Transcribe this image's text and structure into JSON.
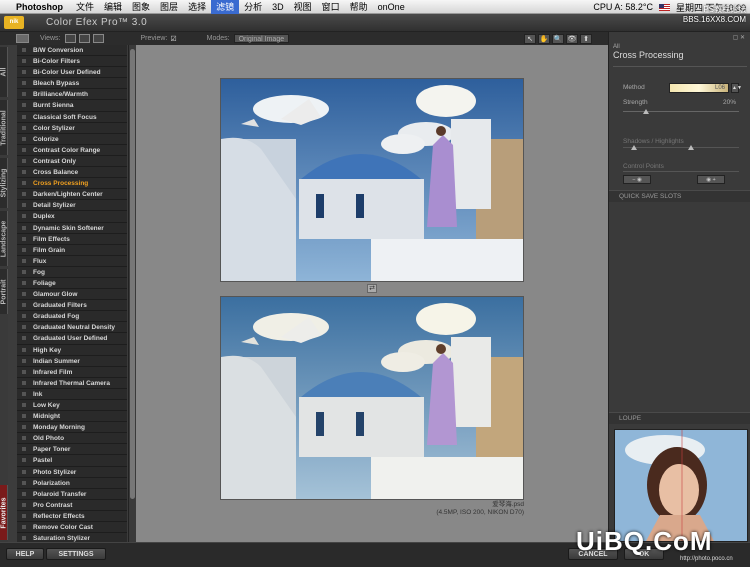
{
  "menubar": {
    "app": "Photoshop",
    "items": [
      "文件",
      "编辑",
      "图象",
      "图层",
      "选择",
      "滤镜",
      "分析",
      "3D",
      "视图",
      "窗口",
      "帮助",
      "onOne"
    ],
    "active_index": 5,
    "status": "CPU A: 58.2°C",
    "clock": "星期四 下午10:00"
  },
  "titlebar": {
    "logo": "nik",
    "title": "Color Efex Pro™ 3.0"
  },
  "toolbar": {
    "views_label": "Views:",
    "preview_label": "Preview:",
    "preview_checked": "☑",
    "modes_label": "Modes:",
    "modes_value": "Original Image",
    "tools": [
      "↖",
      "✋",
      "🔍",
      "👁",
      "⬆"
    ]
  },
  "tabs": [
    "All",
    "Traditional",
    "Stylizing",
    "Landscape",
    "Portrait",
    "Favorites"
  ],
  "filters": [
    "B/W Conversion",
    "Bi-Color Filters",
    "Bi-Color User Defined",
    "Bleach Bypass",
    "Brilliance/Warmth",
    "Burnt Sienna",
    "Classical Soft Focus",
    "Color Stylizer",
    "Colorize",
    "Contrast Color Range",
    "Contrast Only",
    "Cross Balance",
    "Cross Processing",
    "Darken/Lighten Center",
    "Detail Stylizer",
    "Duplex",
    "Dynamic Skin Softener",
    "Film Effects",
    "Film Grain",
    "Flux",
    "Fog",
    "Foliage",
    "Glamour Glow",
    "Graduated Filters",
    "Graduated Fog",
    "Graduated Neutral Density",
    "Graduated User Defined",
    "High Key",
    "Indian Summer",
    "Infrared Film",
    "Infrared Thermal Camera",
    "Ink",
    "Low Key",
    "Midnight",
    "Monday Morning",
    "Old Photo",
    "Paper Toner",
    "Pastel",
    "Photo Stylizer",
    "Polarization",
    "Polaroid Transfer",
    "Pro Contrast",
    "Reflector Effects",
    "Remove Color Cast",
    "Saturation Stylizer"
  ],
  "active_filter": "Cross Processing",
  "preview": {
    "file_name": "爱琴海.psd",
    "file_info": "(4.5MP, ISO 200, NIKON D70)"
  },
  "panel": {
    "filter_category": "All",
    "filter_name": "Cross Processing",
    "method_label": "Method",
    "method_value": "L06",
    "strength_label": "Strength",
    "strength_value": "20%",
    "strength_fraction": 0.2,
    "shadows_label": "Shadows / Highlights",
    "control_points_label": "Control Points",
    "quick_save_label": "QUICK SAVE SLOTS",
    "loupe_label": "LOUPE"
  },
  "bottombar": {
    "help_label": "HELP",
    "settings_label": "SETTINGS",
    "cancel_label": "CANCEL",
    "ok_label": "OK"
  },
  "watermark": {
    "top_line1": "PS教程论坛",
    "top_line2": "BBS.16XX8.COM",
    "logo": "UiBQ.CoM",
    "url": "http://photo.poco.cn"
  }
}
